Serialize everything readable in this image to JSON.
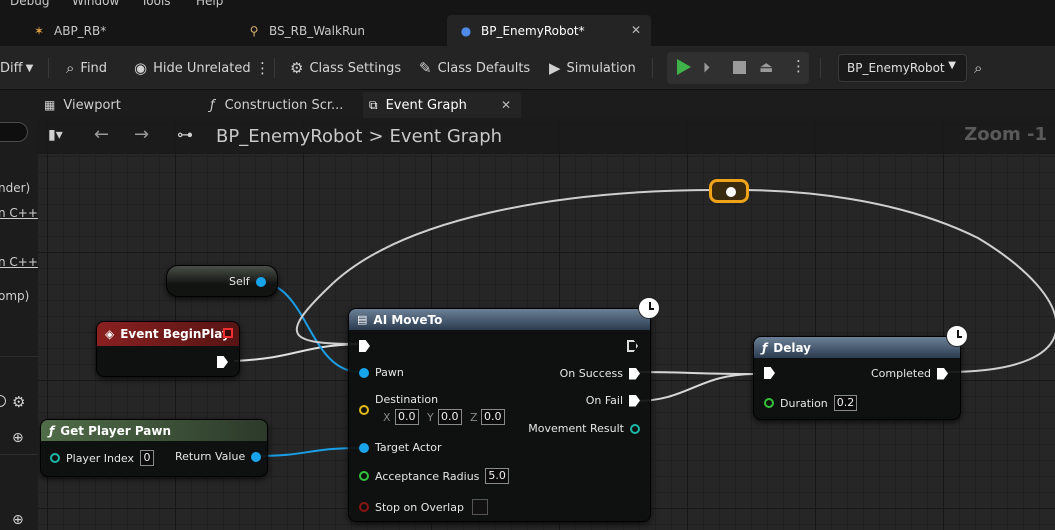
{
  "menu": {
    "items": [
      "Debug",
      "Window",
      "Tools",
      "Help"
    ]
  },
  "tabs": [
    {
      "label": "ABP_RB*",
      "icon": "anim-blueprint-icon"
    },
    {
      "label": "BS_RB_WalkRun",
      "icon": "blendspace-icon"
    },
    {
      "label": "BP_EnemyRobot*",
      "icon": "pawn-blueprint-icon"
    }
  ],
  "toolbar": {
    "diff": "Diff",
    "find": "Find",
    "hide_unrelated": "Hide Unrelated",
    "class_settings": "Class Settings",
    "class_defaults": "Class Defaults",
    "simulation": "Simulation",
    "debug_object": "BP_EnemyRobot"
  },
  "graph_tabs": [
    {
      "label": "Viewport"
    },
    {
      "label": "Construction Scr..."
    },
    {
      "label": "Event Graph"
    }
  ],
  "breadcrumb": {
    "blueprint": "BP_EnemyRobot",
    "graph": "Event Graph"
  },
  "zoom": "Zoom -1",
  "left_panel": {
    "items": [
      "nder)",
      "n C++",
      "n C++",
      "omp)"
    ]
  },
  "nodes": {
    "self": {
      "label": "Self"
    },
    "begin_play": {
      "title": "Event BeginPlay"
    },
    "get_player_pawn": {
      "title": "Get Player Pawn",
      "player_index_label": "Player Index",
      "player_index": "0",
      "return_label": "Return Value"
    },
    "ai_moveto": {
      "title": "AI MoveTo",
      "pawn": "Pawn",
      "destination": "Destination",
      "x_label": "X",
      "x": "0.0",
      "y_label": "Y",
      "y": "0.0",
      "z_label": "Z",
      "z": "0.0",
      "target_actor": "Target Actor",
      "acceptance_radius": "Acceptance Radius",
      "acceptance_value": "5.0",
      "stop_on_overlap": "Stop on Overlap",
      "on_success": "On Success",
      "on_fail": "On Fail",
      "movement_result": "Movement Result"
    },
    "delay": {
      "title": "Delay",
      "duration_label": "Duration",
      "duration": "0.2",
      "completed": "Completed"
    }
  },
  "colors": {
    "exec": "#ffffff",
    "object_pin": "#18a4ea",
    "float_pin": "#34c23a",
    "vector_pin": "#e3b91a",
    "bool_pin": "#8a1414",
    "event_header": "#7a1d1d",
    "function_header": "#3c5a3c",
    "reroute": "#f0a318"
  }
}
